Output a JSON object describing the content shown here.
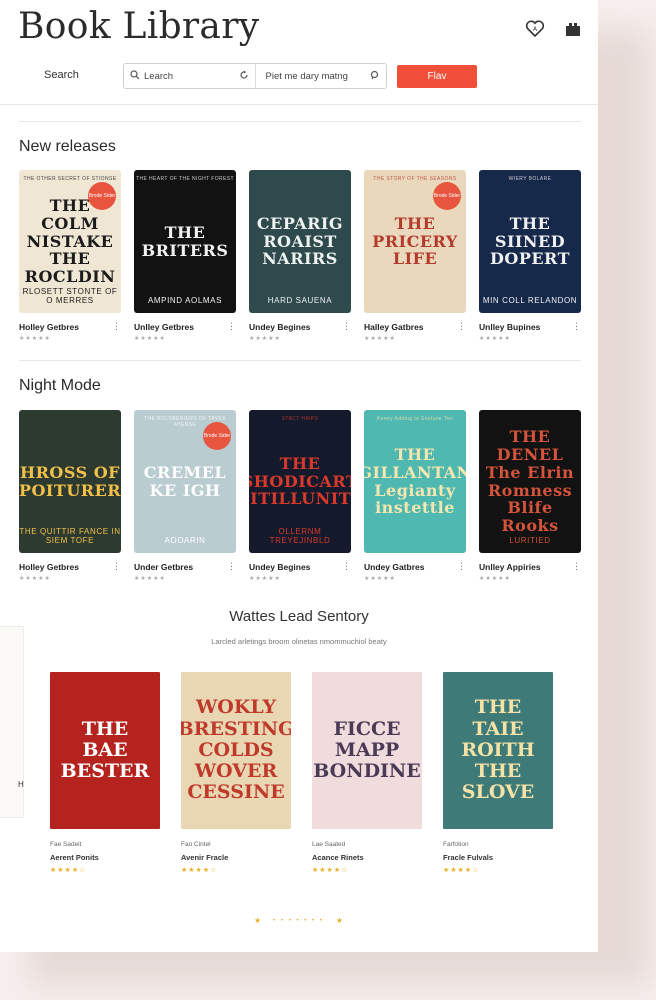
{
  "header": {
    "title": "Book Library",
    "heart_icon": "heart-icon",
    "gift_icon": "gift-icon"
  },
  "search": {
    "label": "Search",
    "field1_value": "Learch",
    "field2_value": "Piet me dary matng",
    "button_label": "Flav"
  },
  "sections": [
    {
      "title": "New releases",
      "books": [
        {
          "cover_title": "THE COLM NISTAKE THE ROCLDIN",
          "cover_author": "RLOSETT STONTE OF O MERRES",
          "cover_top": "THE OTHER SECRET OF STIONSE",
          "name": "Holley Getbres",
          "badge": "Brode Sider",
          "bg": "#efe6d3",
          "fg": "#1b1b1b"
        },
        {
          "cover_title": "THE BRITERS",
          "cover_author": "AMPIND AOLMAS",
          "cover_top": "THE HEART OF THE NIGHT FOREST",
          "name": "Unlley Getbres",
          "badge": "",
          "bg": "#121212",
          "fg": "#f2f2f2"
        },
        {
          "cover_title": "CEPARIG ROAIST NARIRS",
          "cover_author": "HARD SAUENA",
          "cover_top": "",
          "name": "Undey Begines",
          "badge": "",
          "bg": "#2f4a4c",
          "fg": "#eef2f0"
        },
        {
          "cover_title": "THE PRICERY LIFE",
          "cover_author": "",
          "cover_top": "THE STORY OF THE SEASONS",
          "name": "Halley Gatbres",
          "badge": "Brode Sider",
          "bg": "#ead8bd",
          "fg": "#b43a2c"
        },
        {
          "cover_title": "THE SIINED DOPERT",
          "cover_author": "MIN COLL RELANDON",
          "cover_top": "WIERY BOLARE",
          "name": "Unlley Bupines",
          "badge": "",
          "bg": "#17294a",
          "fg": "#f1f1f1"
        }
      ]
    },
    {
      "title": "Night Mode",
      "books": [
        {
          "cover_title": "HROSS OF POITURER",
          "cover_author": "THE QUITTIR FANCE IN SIEM TOFE",
          "cover_top": "",
          "name": "Holley Getbres",
          "badge": "",
          "bg": "#2c3a30",
          "fg": "#f3c14a"
        },
        {
          "cover_title": "CREMEL KE IGH",
          "cover_author": "AOOARIN",
          "cover_top": "THE ROLIIBERIERS OF TAYES AYENSE",
          "name": "Under Getbres",
          "badge": "Brode Sider",
          "bg": "#b9ccd0",
          "fg": "#ffffff"
        },
        {
          "cover_title": "THE SHODICART CITILLUNITY",
          "cover_author": "OLLERNM TREYEJINBLD",
          "cover_top": "STACT HAIPS",
          "name": "Undey Begines",
          "badge": "",
          "bg": "#141a2c",
          "fg": "#d8392b"
        },
        {
          "cover_title": "THE GILLANTAN Legianty instettle",
          "cover_author": "",
          "cover_top": "Kenny Adding to Sostune Ton",
          "name": "Undey Gatbres",
          "badge": "",
          "bg": "#4fb8b0",
          "fg": "#f6e6b0"
        },
        {
          "cover_title": "THE DENEL The Elrin Romness Blife Rooks",
          "cover_author": "LURITIED",
          "cover_top": "",
          "name": "Unlley Appiries",
          "badge": "",
          "bg": "#121212",
          "fg": "#d4533b"
        }
      ]
    }
  ],
  "featured": {
    "title": "Wattes Lead Sentory",
    "subtitle": "Larcled arletings broom olinetas nmommuchiol beaty",
    "peek_letter": "H",
    "books": [
      {
        "cover_title": "THE BAE BESTER",
        "sub": "Fae Sadeit",
        "name": "Aerent Ponits",
        "bg": "#b5231f",
        "fg": "#ffffff"
      },
      {
        "cover_title": "WOKLY BRESTING COLDS WOVER CESSINE",
        "sub": "Fao Cintel",
        "name": "Avenir Fracle",
        "bg": "#e9d7b4",
        "fg": "#c03a2b"
      },
      {
        "cover_title": "FICCE MAPP BONDINE",
        "sub": "Lae Saated",
        "name": "Acance Rinets",
        "bg": "#f0dcdc",
        "fg": "#4a3a55"
      },
      {
        "cover_title": "THE TAIE ROITH THE SLOVE",
        "sub": "Farfotion",
        "name": "Fracle Fulvals",
        "bg": "#3d7a78",
        "fg": "#f4e2a6"
      }
    ]
  },
  "pager": {
    "left": "★",
    "dots": "• • • • • • •",
    "right": "★"
  }
}
